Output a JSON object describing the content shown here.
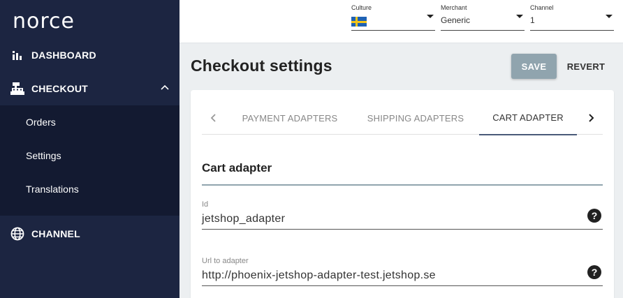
{
  "app": {
    "logo": "norce"
  },
  "sidebar": {
    "items": [
      {
        "label": "DASHBOARD",
        "icon": "bar-chart-icon"
      },
      {
        "label": "CHECKOUT",
        "icon": "cash-register-icon",
        "expanded": true
      },
      {
        "label": "CHANNEL",
        "icon": "globe-icon"
      }
    ],
    "submenu": [
      "Orders",
      "Settings",
      "Translations"
    ]
  },
  "topbar": {
    "culture": {
      "caption": "Culture",
      "value_icon": "sweden-flag-icon"
    },
    "merchant": {
      "caption": "Merchant",
      "value": "Generic"
    },
    "channel": {
      "caption": "Channel",
      "value": "1"
    }
  },
  "page": {
    "title": "Checkout settings",
    "save_label": "SAVE",
    "revert_label": "REVERT"
  },
  "tabs": [
    {
      "label": "PAYMENT ADAPTERS",
      "active": false
    },
    {
      "label": "SHIPPING ADAPTERS",
      "active": false
    },
    {
      "label": "CART ADAPTER",
      "active": true
    }
  ],
  "section": {
    "title": "Cart adapter",
    "fields": [
      {
        "label": "Id",
        "value": "jetshop_adapter",
        "help": "?"
      },
      {
        "label": "Url to adapter",
        "value": "http://phoenix-jetshop-adapter-test.jetshop.se",
        "help": "?"
      }
    ]
  },
  "colors": {
    "sidebar": "#1c2541",
    "submenu": "#131a31",
    "save_button": "#90a4ae",
    "tab_indicator": "#4a5a78"
  }
}
